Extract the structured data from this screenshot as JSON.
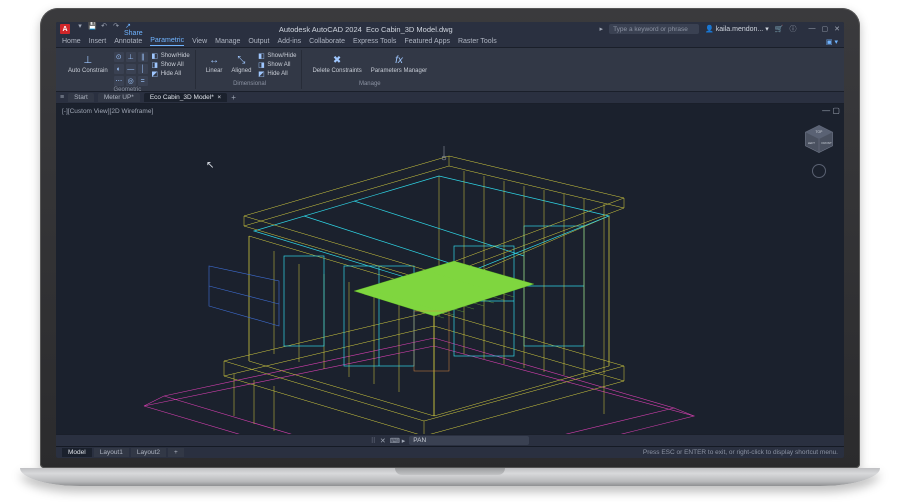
{
  "title_app": "Autodesk AutoCAD 2024",
  "title_file": "Eco Cabin_3D Model.dwg",
  "share_label": "Share",
  "search_placeholder": "Type a keyword or phrase",
  "user_name": "kaila.mendon...",
  "menu": [
    "Home",
    "Insert",
    "Annotate",
    "Parametric",
    "View",
    "Manage",
    "Output",
    "Add-ins",
    "Collaborate",
    "Express Tools",
    "Featured Apps",
    "Raster Tools"
  ],
  "menu_active_index": 3,
  "ribbon": {
    "geometric": {
      "auto_constrain": "Auto\nConstrain",
      "showhide": "Show/Hide",
      "showall": "Show All",
      "hideall": "Hide All",
      "label": "Geometric"
    },
    "dimensional": {
      "linear": "Linear",
      "aligned": "Aligned",
      "showhide": "Show/Hide",
      "showall": "Show All",
      "hideall": "Hide All",
      "label": "Dimensional"
    },
    "manage": {
      "delete": "Delete\nConstraints",
      "param_mgr": "Parameters\nManager",
      "fx": "fx",
      "label": "Manage"
    }
  },
  "doc_tabs": {
    "start": "Start",
    "meterup": "Meter UP*",
    "active": "Eco Cabin_3D Model*"
  },
  "viewport_label": "[-][Custom View][2D Wireframe]",
  "viewcube": {
    "top": "TOP",
    "left": "LEFT",
    "front": "FRONT"
  },
  "command_prompt": "PAN",
  "layout_tabs": [
    "Model",
    "Layout1",
    "Layout2"
  ],
  "layout_active_index": 0,
  "status_hint": "Press ESC or ENTER to exit, or right-click to display shortcut menu.",
  "colors": {
    "magenta": "#d63fb0",
    "cyan": "#2fd6e6",
    "yellow": "#d6cf3f",
    "green": "#7fd63f",
    "blue": "#3f6fd6",
    "orange": "#d6843f"
  }
}
